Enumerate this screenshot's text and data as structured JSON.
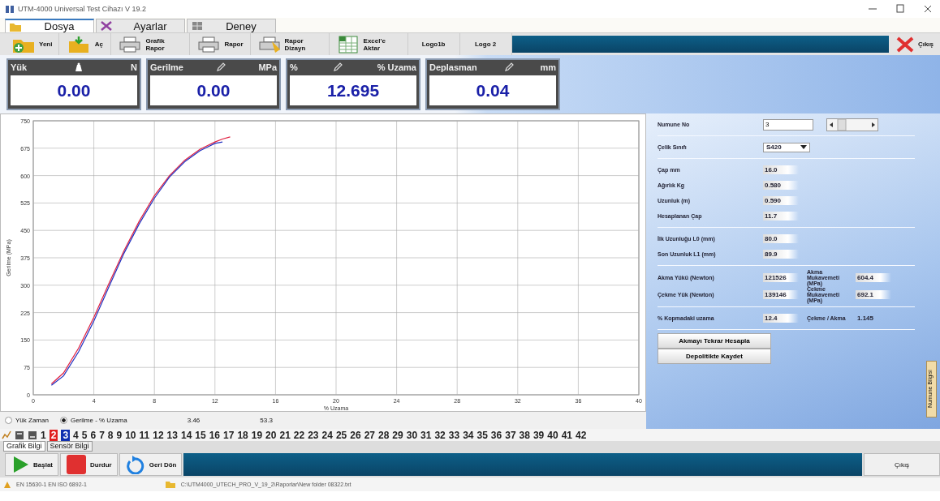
{
  "window": {
    "title": "UTM-4000 Universal Test Cihazı V 19.2"
  },
  "tabs": [
    {
      "label": "Dosya",
      "selected": true
    },
    {
      "label": "Ayarlar",
      "selected": false
    },
    {
      "label": "Deney",
      "selected": false
    }
  ],
  "toolbar": [
    {
      "label": "Yeni"
    },
    {
      "label": "Aç"
    },
    {
      "label": "Grafik Rapor"
    },
    {
      "label": "Rapor"
    },
    {
      "label": "Rapor Dizayn"
    },
    {
      "label": "Excel'e Aktar"
    },
    {
      "label": "Logo1b"
    },
    {
      "label": "Logo 2"
    }
  ],
  "exit_top": {
    "label": "Çıkış"
  },
  "meters": [
    {
      "label": "Yük",
      "unit": "N",
      "value": "0.00"
    },
    {
      "label": "Gerilme",
      "unit": "MPa",
      "value": "0.00"
    },
    {
      "label": "%",
      "unit": "% Uzama",
      "value": "12.695"
    },
    {
      "label": "Deplasman",
      "unit": "mm",
      "value": "0.04"
    }
  ],
  "chart": {
    "chart_data": {
      "type": "line",
      "grid": true,
      "xlabel": "% Uzama",
      "ylabel": "Gerilme (MPa)",
      "x": [
        1.2,
        2,
        3,
        4,
        5,
        6,
        7,
        8,
        9,
        10,
        11,
        12,
        12.5,
        13
      ],
      "xlim": [
        0,
        40
      ],
      "ylim": [
        0,
        750
      ],
      "xticks": [
        0,
        4,
        8,
        12,
        16,
        20,
        24,
        28,
        32,
        36,
        40
      ],
      "yticks": [
        0,
        75,
        150,
        225,
        300,
        375,
        450,
        525,
        600,
        675,
        750
      ],
      "series": [
        {
          "color": "#e02040",
          "values": [
            30,
            60,
            128,
            212,
            305,
            395,
            475,
            545,
            600,
            642,
            672,
            692,
            700,
            706
          ]
        },
        {
          "color": "#2030c0",
          "values": [
            26,
            52,
            118,
            202,
            296,
            388,
            468,
            538,
            596,
            638,
            668,
            688,
            692,
            null
          ]
        }
      ]
    }
  },
  "plot_mode": [
    {
      "label": "Yük Zaman",
      "selected": false
    },
    {
      "label": "Gerilme - % Uzama",
      "selected": true
    }
  ],
  "readouts": [
    "3.46",
    "53.3"
  ],
  "samples": [
    {
      "label": "1"
    },
    {
      "label": "2",
      "color": "#e02020"
    },
    {
      "label": "3",
      "color": "#1030b0"
    },
    {
      "label": "4"
    },
    {
      "label": "5"
    },
    {
      "label": "6"
    },
    {
      "label": "7"
    },
    {
      "label": "8"
    },
    {
      "label": "9"
    },
    {
      "label": "10"
    },
    {
      "label": "11"
    },
    {
      "label": "12"
    },
    {
      "label": "13"
    },
    {
      "label": "14"
    },
    {
      "label": "15"
    },
    {
      "label": "16"
    },
    {
      "label": "17"
    },
    {
      "label": "18"
    },
    {
      "label": "19"
    },
    {
      "label": "20"
    },
    {
      "label": "21"
    },
    {
      "label": "22"
    },
    {
      "label": "23"
    },
    {
      "label": "24"
    },
    {
      "label": "25"
    },
    {
      "label": "26"
    },
    {
      "label": "27"
    },
    {
      "label": "28"
    },
    {
      "label": "29"
    },
    {
      "label": "30"
    },
    {
      "label": "31"
    },
    {
      "label": "32"
    },
    {
      "label": "33"
    },
    {
      "label": "34"
    },
    {
      "label": "35"
    },
    {
      "label": "36"
    },
    {
      "label": "37"
    },
    {
      "label": "38"
    },
    {
      "label": "39"
    },
    {
      "label": "40"
    },
    {
      "label": "41"
    },
    {
      "label": "42"
    }
  ],
  "info_tabs": [
    {
      "label": "Grafik Bilgi",
      "selected": true
    },
    {
      "label": "Sensör Bilgi",
      "selected": false
    }
  ],
  "specimen": {
    "number": {
      "label": "Numune No",
      "value": "3"
    },
    "steel_class": {
      "label": "Çelik Sınıfı",
      "value": "S420"
    },
    "groups": [
      [
        {
          "label": "Çap mm",
          "value": "16.0"
        },
        {
          "label": "Ağırlık Kg",
          "value": "0.580"
        },
        {
          "label": "Uzunluk (m)",
          "value": "0.590"
        },
        {
          "label": "Hesaplanan Çap",
          "value": "11.7"
        }
      ],
      [
        {
          "label": "İlk Uzunluğu L0 (mm)",
          "value": "80.0"
        },
        {
          "label": "Son Uzunluk  L1 (mm)",
          "value": "89.9"
        }
      ],
      [
        {
          "label": "Akma Yükü (Newton)",
          "value": "121526",
          "label_2": "Akma Mukavemeti (MPa)",
          "value_2": "604.4"
        },
        {
          "label": "Çekme Yük (Newton)",
          "value": "139146",
          "label_2": "Çekme Mukavemeti (MPa)",
          "value_2": "692.1"
        }
      ],
      [
        {
          "label": "% Kopmadaki uzama",
          "value": "12.4",
          "label_2": "Çekme / Akma",
          "value_2": "1.145",
          "plain_2": true
        }
      ]
    ],
    "buttons": [
      "Akmayı Tekrar Hesapla",
      "Depolitikte Kaydet"
    ],
    "side_tab": "Numune Bilgisi"
  },
  "controls": [
    {
      "label": "Başlat"
    },
    {
      "label": "Durdur"
    },
    {
      "label": "Geri Dön"
    }
  ],
  "exit_bottom": {
    "label": "Çıkış"
  },
  "status_bar": {
    "standard": "EN 15630-1 EN ISO 6892-1",
    "file": "C:\\UTM4000_UTECH_PRO_V_19_2\\Raporlar\\New folder 08322.txt"
  }
}
